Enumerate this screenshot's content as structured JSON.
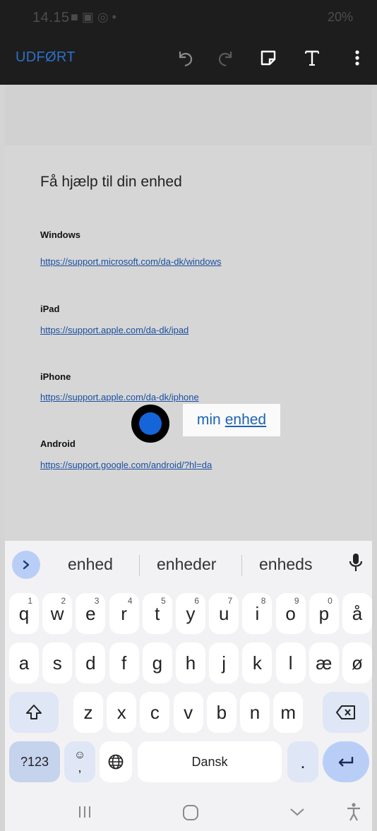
{
  "status_bar": {
    "time": "14.15",
    "icons": "■ ▣ ◎ •",
    "right": "20%"
  },
  "toolbar": {
    "done_label": "UDFØRT"
  },
  "document": {
    "heading": "Få hjælp til din enhed",
    "sections": [
      {
        "title": "Windows",
        "link": "https://support.microsoft.com/da-dk/windows"
      },
      {
        "title": "iPad",
        "link": "https://support.apple.com/da-dk/ipad"
      },
      {
        "title": "iPhone",
        "link": "https://support.apple.com/da-dk/iphone"
      },
      {
        "title": "Android",
        "link": "https://support.google.com/android/?hl=da"
      }
    ]
  },
  "edit_box": {
    "word1": "min",
    "word2": "enhed"
  },
  "keyboard": {
    "suggestions": [
      "enhed",
      "enheder",
      "enheds"
    ],
    "row1": [
      {
        "k": "q",
        "n": "1"
      },
      {
        "k": "w",
        "n": "2"
      },
      {
        "k": "e",
        "n": "3"
      },
      {
        "k": "r",
        "n": "4"
      },
      {
        "k": "t",
        "n": "5"
      },
      {
        "k": "y",
        "n": "6"
      },
      {
        "k": "u",
        "n": "7"
      },
      {
        "k": "i",
        "n": "8"
      },
      {
        "k": "o",
        "n": "9"
      },
      {
        "k": "p",
        "n": "0"
      },
      {
        "k": "å",
        "n": ""
      }
    ],
    "row2": [
      "a",
      "s",
      "d",
      "f",
      "g",
      "h",
      "j",
      "k",
      "l",
      "æ",
      "ø"
    ],
    "row3": [
      "z",
      "x",
      "c",
      "v",
      "b",
      "n",
      "m"
    ],
    "symbols_label": "?123",
    "emoji_comma": ",",
    "space_label": "Dansk",
    "period": "."
  },
  "colors": {
    "accent": "#2f6fc7",
    "link": "#1a4fa0",
    "marker": "#1565d8"
  }
}
